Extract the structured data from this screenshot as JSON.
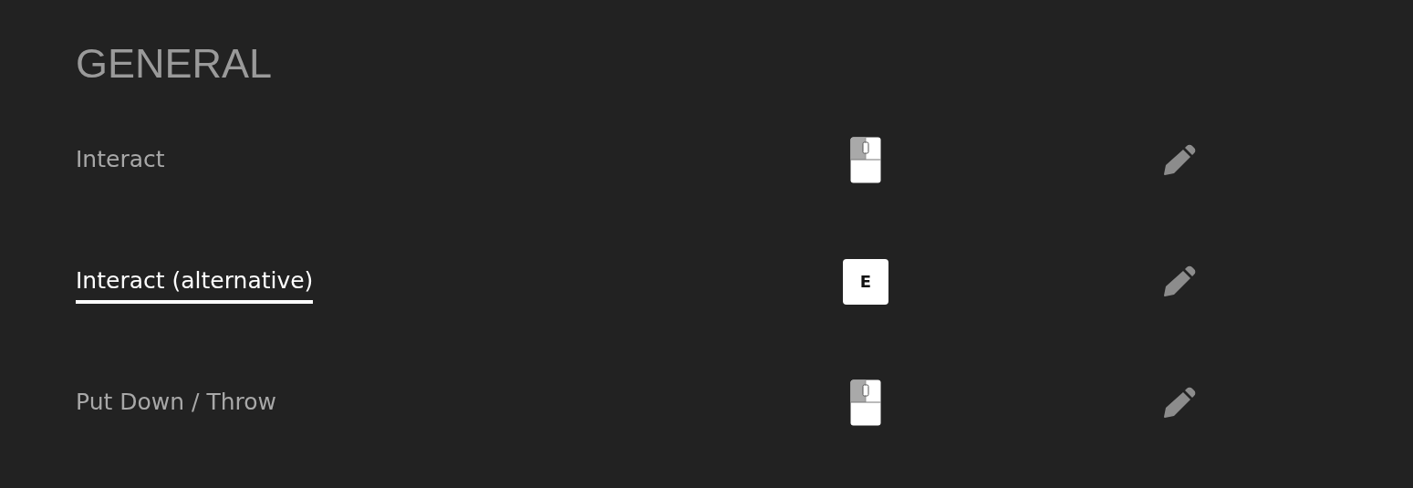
{
  "section": {
    "title": "GENERAL"
  },
  "bindings": [
    {
      "label": "Interact",
      "selected": false,
      "binding": {
        "kind": "mouse-left"
      }
    },
    {
      "label": "Interact (alternative)",
      "selected": true,
      "binding": {
        "kind": "key",
        "key": "E"
      }
    },
    {
      "label": "Put Down / Throw",
      "selected": false,
      "binding": {
        "kind": "mouse-left"
      }
    }
  ]
}
